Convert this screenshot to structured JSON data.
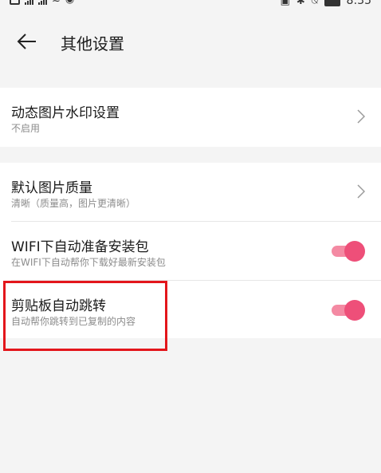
{
  "status_bar": {
    "time": "8:35"
  },
  "header": {
    "title": "其他设置"
  },
  "settings": {
    "dynamic_watermark": {
      "title": "动态图片水印设置",
      "subtitle": "不启用"
    },
    "image_quality": {
      "title": "默认图片质量",
      "subtitle": "清晰（质量高，图片更清晰）"
    },
    "wifi_download": {
      "title": "WIFI下自动准备安装包",
      "subtitle": "在WIFI下自动帮你下载好最新安装包",
      "enabled": true
    },
    "clipboard_jump": {
      "title": "剪贴板自动跳转",
      "subtitle": "自动帮你跳转到已复制的内容",
      "enabled": true
    }
  },
  "colors": {
    "toggle_track": "#f48aa3",
    "toggle_knob": "#ee4f79",
    "highlight": "#e3161b"
  },
  "icons": {
    "back": "back-arrow-icon",
    "chevron": "chevron-right-icon"
  }
}
